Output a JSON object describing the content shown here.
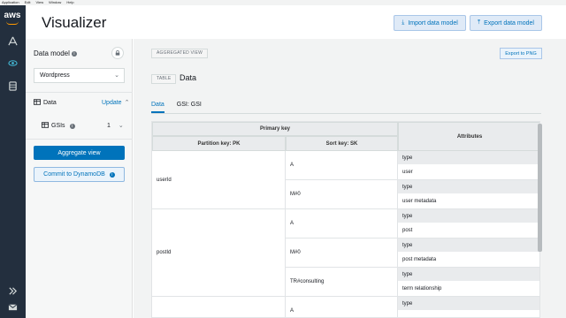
{
  "menubar": [
    "Application",
    "Edit",
    "View",
    "Window",
    "Help"
  ],
  "rail": {
    "logo": "aws",
    "icons": [
      "operation-builder-icon",
      "visualizer-icon",
      "database-icon",
      "expand-icon",
      "mail-icon"
    ]
  },
  "header": {
    "title": "Visualizer",
    "import_label": "Import data model",
    "export_label": "Export data model"
  },
  "panel": {
    "data_model_label": "Data model",
    "selected_model": "Wordpress",
    "data_label": "Data",
    "update_link": "Update",
    "gsis_label": "GSIs",
    "gsis_count": "1",
    "aggregate_button": "Aggregate view",
    "commit_button": "Commit to DynamoDB"
  },
  "main": {
    "view_chip": "AGGREGATED VIEW",
    "export_png": "Export to PNG",
    "table_chip": "TABLE",
    "table_name": "Data",
    "tabs": [
      "Data",
      "GSI: GSI"
    ],
    "active_tab": 0
  },
  "grid": {
    "primary_key_header": "Primary key",
    "partition_key_header": "Partition key: PK",
    "sort_key_header": "Sort key: SK",
    "attributes_header": "Attributes",
    "partitions": [
      {
        "pk": "userId",
        "items": [
          {
            "sk": "A",
            "attr_name": "type",
            "attr_value": "user"
          },
          {
            "sk": "M#0",
            "attr_name": "type",
            "attr_value": "user metadata"
          }
        ]
      },
      {
        "pk": "postId",
        "items": [
          {
            "sk": "A",
            "attr_name": "type",
            "attr_value": "post"
          },
          {
            "sk": "M#0",
            "attr_name": "type",
            "attr_value": "post metadata"
          },
          {
            "sk": "TR#consulting",
            "attr_name": "type",
            "attr_value": "term relationship"
          }
        ]
      },
      {
        "pk": "",
        "items": [
          {
            "sk": "A",
            "attr_name": "type",
            "attr_value": ""
          }
        ]
      }
    ]
  },
  "colors": {
    "rail": "#232f3e",
    "accent": "#0073bb",
    "aws_orange": "#ff9900"
  }
}
